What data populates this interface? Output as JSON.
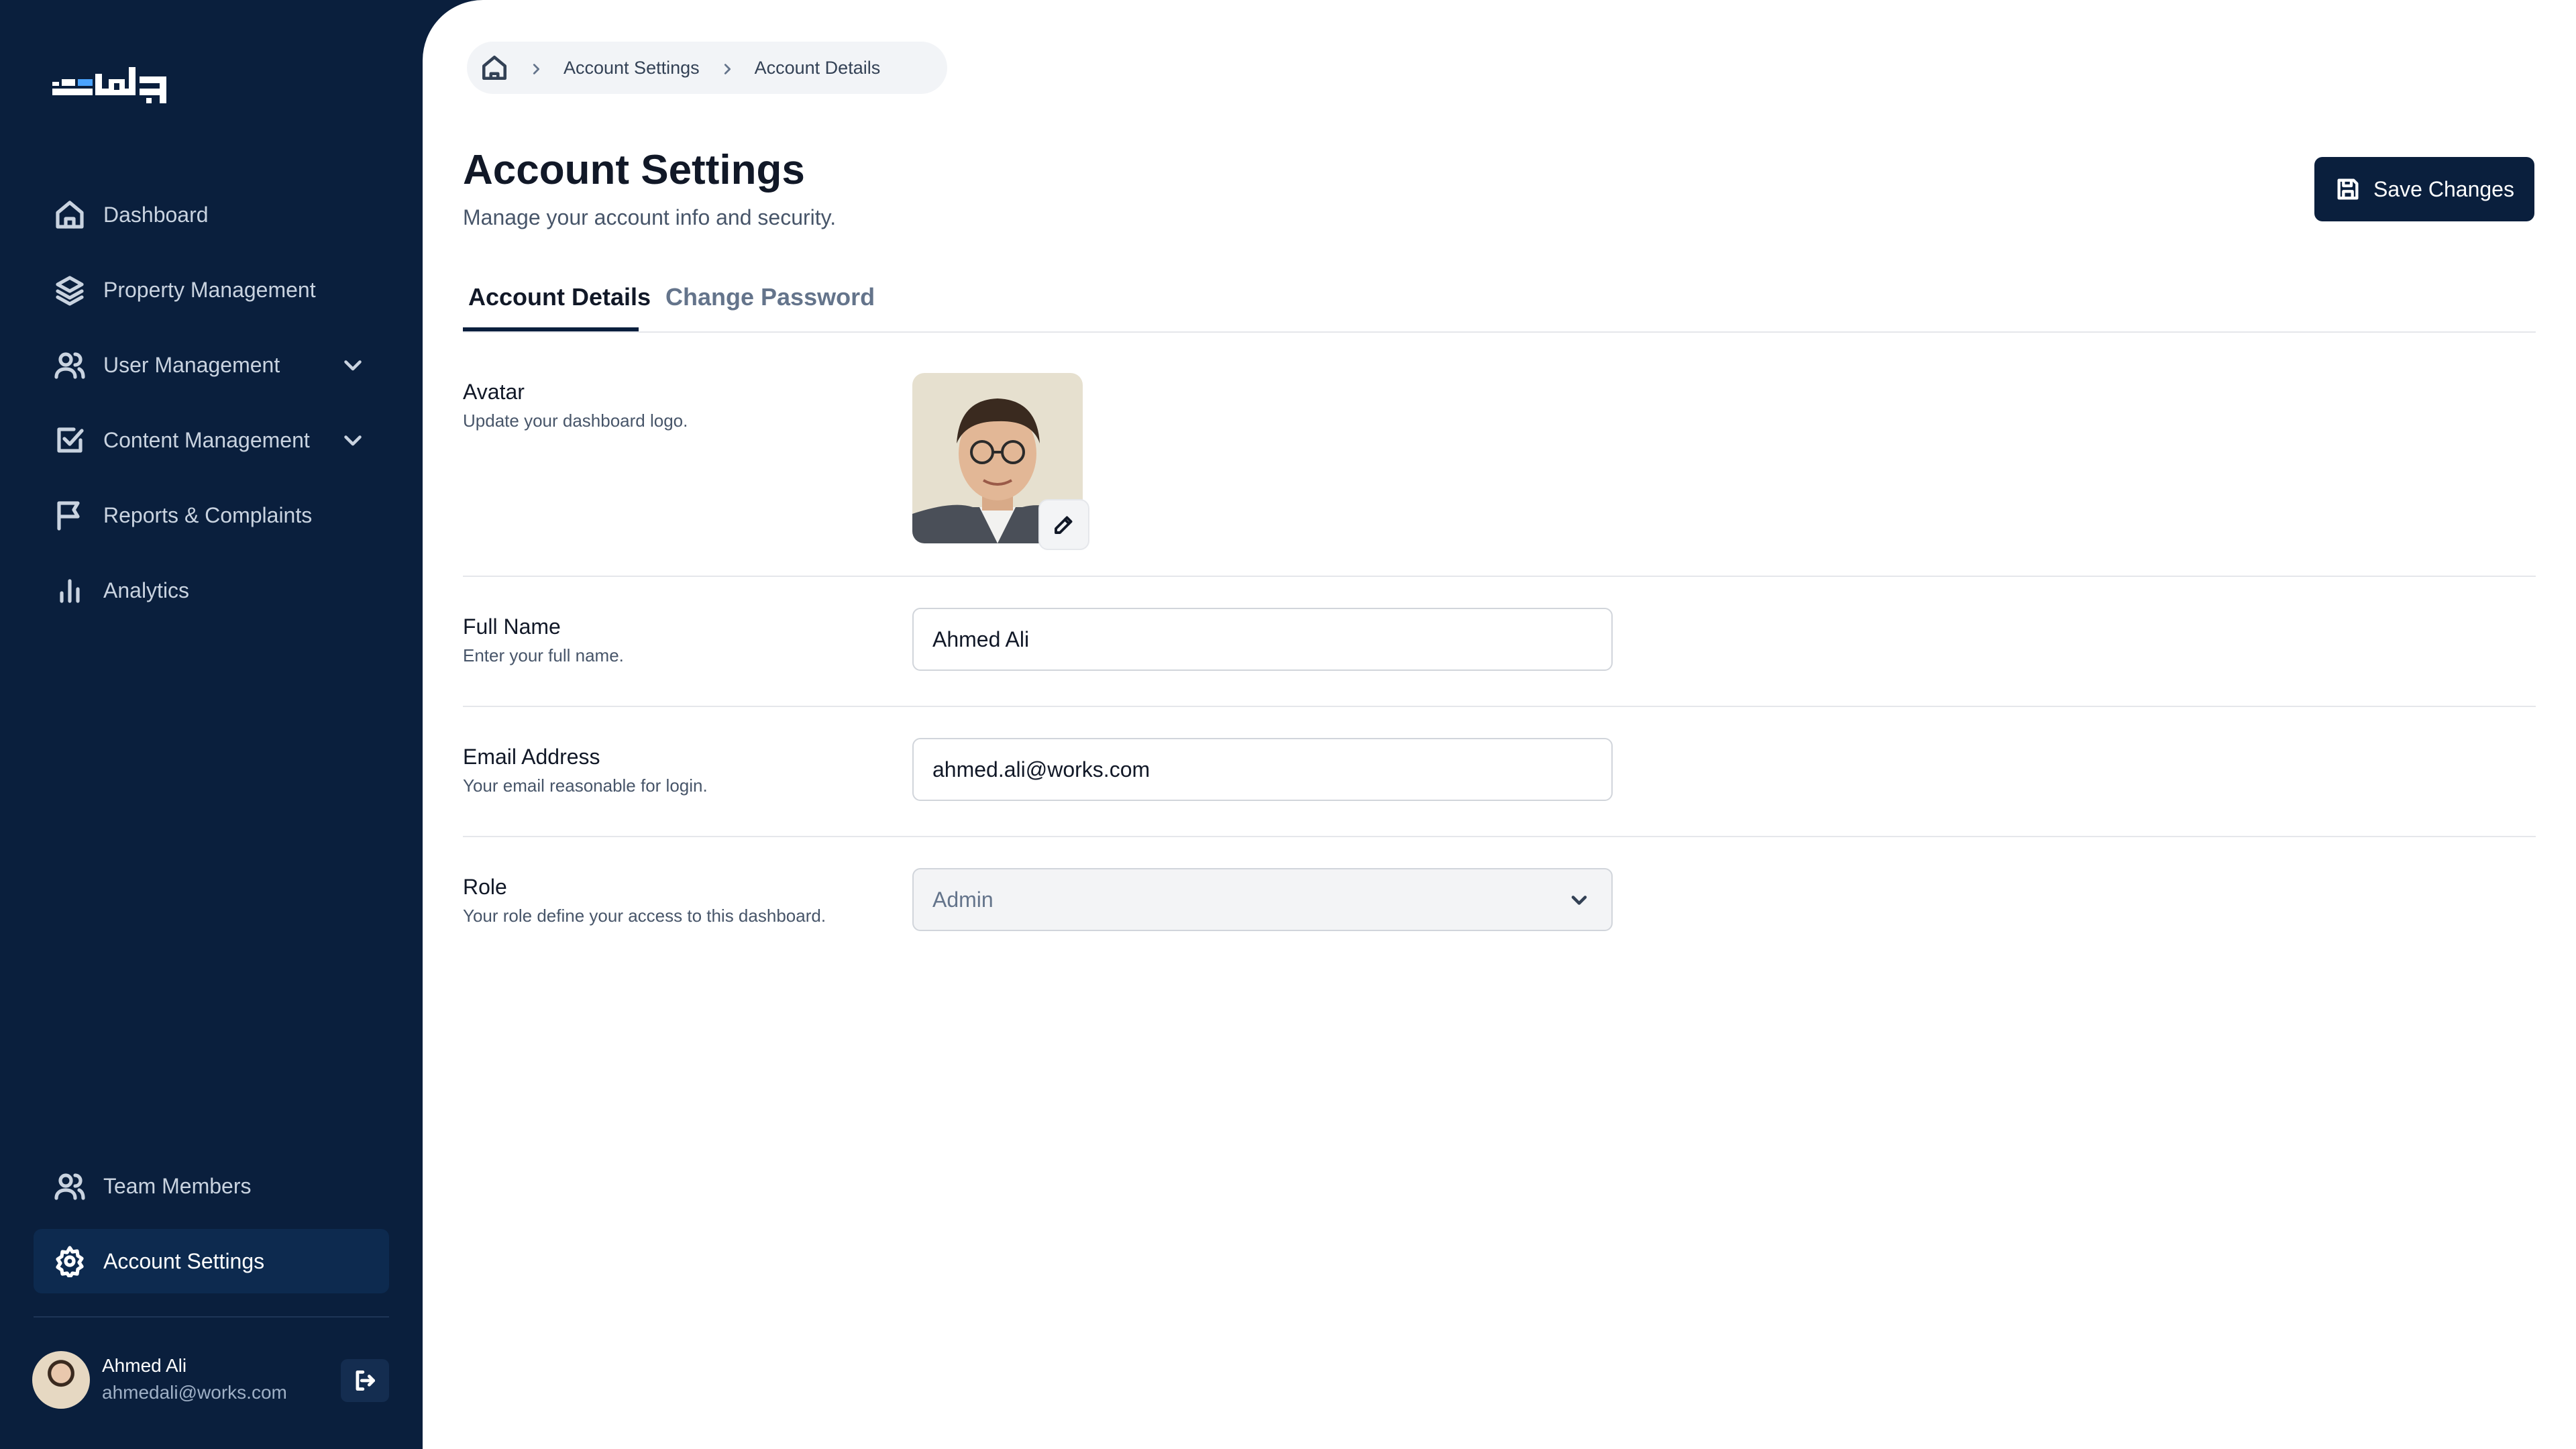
{
  "sidebar": {
    "nav": [
      {
        "label": "Dashboard",
        "icon": "home-icon"
      },
      {
        "label": "Property Management",
        "icon": "layers-icon"
      },
      {
        "label": "User Management",
        "icon": "users-icon",
        "expandable": true
      },
      {
        "label": "Content Management",
        "icon": "check-square-icon",
        "expandable": true
      },
      {
        "label": "Reports & Complaints",
        "icon": "flag-icon"
      },
      {
        "label": "Analytics",
        "icon": "bar-chart-icon"
      }
    ],
    "bottom_nav": [
      {
        "label": "Team Members",
        "icon": "users-icon"
      },
      {
        "label": "Account Settings",
        "icon": "gear-icon",
        "active": true
      }
    ],
    "user": {
      "name": "Ahmed Ali",
      "email": "ahmedali@works.com"
    }
  },
  "breadcrumb": [
    "Account Settings",
    "Account Details"
  ],
  "header": {
    "title": "Account Settings",
    "subtitle": "Manage your account info and security.",
    "save_label": "Save Changes"
  },
  "tabs": [
    {
      "label": "Account Details",
      "active": true
    },
    {
      "label": "Change Password",
      "active": false
    }
  ],
  "form": {
    "avatar": {
      "label": "Avatar",
      "desc": "Update your dashboard logo."
    },
    "full_name": {
      "label": "Full Name",
      "desc": "Enter your full name.",
      "value": "Ahmed Ali"
    },
    "email": {
      "label": "Email Address",
      "desc": "Your email reasonable for login.",
      "value": "ahmed.ali@works.com"
    },
    "role": {
      "label": "Role",
      "desc": "Your role define your access to this dashboard.",
      "value": "Admin"
    }
  },
  "colors": {
    "sidebar_bg": "#0a1f3d",
    "accent": "#0a1f3d",
    "active_item": "#0d2a4f"
  }
}
